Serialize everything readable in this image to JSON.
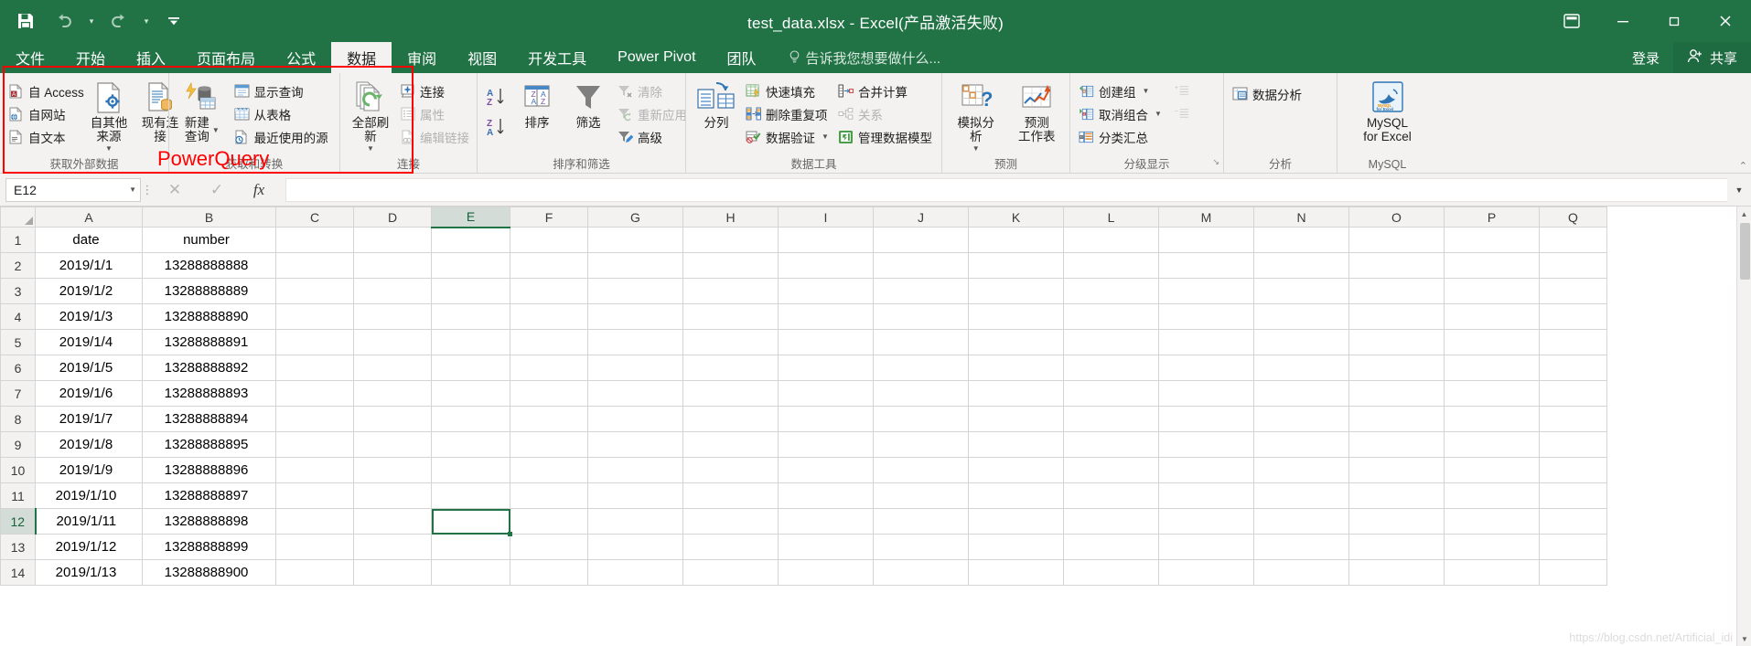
{
  "window": {
    "title": "test_data.xlsx - Excel(产品激活失败)",
    "quick_access": {
      "save": "save-icon",
      "undo": "undo-icon",
      "redo": "redo-icon",
      "customize": "customize-qat-icon"
    },
    "controls": {
      "ribbon_display": "ribbon-display-options",
      "minimize": "—",
      "restore": "restore",
      "close": "✕"
    }
  },
  "tabs": [
    {
      "label": "文件",
      "active": false
    },
    {
      "label": "开始",
      "active": false
    },
    {
      "label": "插入",
      "active": false
    },
    {
      "label": "页面布局",
      "active": false
    },
    {
      "label": "公式",
      "active": false
    },
    {
      "label": "数据",
      "active": true
    },
    {
      "label": "审阅",
      "active": false
    },
    {
      "label": "视图",
      "active": false
    },
    {
      "label": "开发工具",
      "active": false
    },
    {
      "label": "Power Pivot",
      "active": false
    },
    {
      "label": "团队",
      "active": false
    }
  ],
  "tellme": {
    "label": "告诉我您想要做什么...",
    "icon": "lightbulb-icon"
  },
  "account": {
    "signin": "登录",
    "share": "共享",
    "share_icon": "share-person-icon"
  },
  "ribbon": {
    "groups": [
      {
        "label": "获取外部数据",
        "small": [
          {
            "label": "自 Access",
            "icon": "access-file-icon",
            "disabled": false
          },
          {
            "label": "自网站",
            "icon": "web-globe-icon",
            "disabled": false
          },
          {
            "label": "自文本",
            "icon": "text-file-icon",
            "disabled": false
          }
        ],
        "big": [
          {
            "label": "自其他来源",
            "icon": "other-sources-icon",
            "dropdown": true
          },
          {
            "label": "现有连接",
            "icon": "existing-connection-icon",
            "dropdown": false
          }
        ]
      },
      {
        "label": "获取和转换",
        "big": [
          {
            "label": "新建\n查询",
            "icon": "new-query-icon",
            "dropdown": true,
            "inline_caret": true
          }
        ],
        "small": [
          {
            "label": "显示查询",
            "icon": "show-queries-icon",
            "disabled": false
          },
          {
            "label": "从表格",
            "icon": "from-table-icon",
            "disabled": false
          },
          {
            "label": "最近使用的源",
            "icon": "recent-sources-icon",
            "disabled": false
          }
        ]
      },
      {
        "label": "连接",
        "big": [
          {
            "label": "全部刷新",
            "icon": "refresh-all-icon",
            "dropdown": true
          }
        ],
        "small": [
          {
            "label": "连接",
            "icon": "connections-icon",
            "disabled": false
          },
          {
            "label": "属性",
            "icon": "properties-icon",
            "disabled": true
          },
          {
            "label": "编辑链接",
            "icon": "edit-links-icon",
            "disabled": true
          }
        ]
      },
      {
        "label": "排序和筛选",
        "sortbtns": [
          {
            "label": "升序排序",
            "icon": "sort-az-icon"
          },
          {
            "label": "降序排序",
            "icon": "sort-za-icon"
          }
        ],
        "big": [
          {
            "label": "排序",
            "icon": "sort-dialog-icon",
            "dropdown": false
          },
          {
            "label": "筛选",
            "icon": "filter-icon",
            "dropdown": false
          }
        ],
        "small": [
          {
            "label": "清除",
            "icon": "clear-filter-icon",
            "disabled": true
          },
          {
            "label": "重新应用",
            "icon": "reapply-icon",
            "disabled": true
          },
          {
            "label": "高级",
            "icon": "advanced-filter-icon",
            "disabled": false
          }
        ]
      },
      {
        "label": "数据工具",
        "big": [
          {
            "label": "分列",
            "icon": "text-to-columns-icon",
            "dropdown": false
          }
        ],
        "small": [
          {
            "label": "快速填充",
            "icon": "flash-fill-icon",
            "disabled": false
          },
          {
            "label": "删除重复项",
            "icon": "remove-duplicates-icon",
            "disabled": false
          },
          {
            "label": "数据验证",
            "icon": "data-validation-icon",
            "disabled": false,
            "caret": true
          }
        ],
        "small2": [
          {
            "label": "合并计算",
            "icon": "consolidate-icon",
            "disabled": false
          },
          {
            "label": "关系",
            "icon": "relationships-icon",
            "disabled": true
          },
          {
            "label": "管理数据模型",
            "icon": "manage-data-model-icon",
            "disabled": false
          }
        ]
      },
      {
        "label": "预测",
        "big": [
          {
            "label": "模拟分析",
            "icon": "what-if-analysis-icon",
            "dropdown": true
          },
          {
            "label": "预测\n工作表",
            "icon": "forecast-sheet-icon",
            "dropdown": false
          }
        ]
      },
      {
        "label": "分级显示",
        "small": [
          {
            "label": "创建组",
            "icon": "group-icon",
            "disabled": false,
            "caret": true
          },
          {
            "label": "取消组合",
            "icon": "ungroup-icon",
            "disabled": false,
            "caret": true
          },
          {
            "label": "分类汇总",
            "icon": "subtotal-icon",
            "disabled": false
          }
        ],
        "small2": [
          {
            "label": "",
            "icon": "show-detail-icon",
            "disabled": true
          },
          {
            "label": "",
            "icon": "hide-detail-icon",
            "disabled": true
          }
        ],
        "dialog_launcher": "↘"
      },
      {
        "label": "分析",
        "small": [
          {
            "label": "数据分析",
            "icon": "data-analysis-icon",
            "disabled": false
          }
        ]
      },
      {
        "label": "MySQL",
        "big": [
          {
            "label": "MySQL\nfor Excel",
            "icon": "mysql-dolphin-icon",
            "dropdown": false
          }
        ]
      }
    ],
    "collapse": "collapse-ribbon-icon"
  },
  "annotation": {
    "text": "PowerQuery",
    "color": "#ff0000"
  },
  "formula_bar": {
    "name_box": "E12",
    "cancel_icon": "cancel-icon",
    "enter_icon": "confirm-icon",
    "function_icon": "fx",
    "value": "",
    "expand_icon": "expand-formula-bar-icon"
  },
  "sheet": {
    "columns": [
      "A",
      "B",
      "C",
      "D",
      "E",
      "F",
      "G",
      "H",
      "I",
      "J",
      "K",
      "L",
      "M",
      "N",
      "O",
      "P",
      "Q"
    ],
    "selected_column": "E",
    "selected_row": 12,
    "active_cell": "E12",
    "rows": [
      {
        "n": 1,
        "A": "date",
        "B": "number"
      },
      {
        "n": 2,
        "A": "2019/1/1",
        "B": "13288888888"
      },
      {
        "n": 3,
        "A": "2019/1/2",
        "B": "13288888889"
      },
      {
        "n": 4,
        "A": "2019/1/3",
        "B": "13288888890"
      },
      {
        "n": 5,
        "A": "2019/1/4",
        "B": "13288888891"
      },
      {
        "n": 6,
        "A": "2019/1/5",
        "B": "13288888892"
      },
      {
        "n": 7,
        "A": "2019/1/6",
        "B": "13288888893"
      },
      {
        "n": 8,
        "A": "2019/1/7",
        "B": "13288888894"
      },
      {
        "n": 9,
        "A": "2019/1/8",
        "B": "13288888895"
      },
      {
        "n": 10,
        "A": "2019/1/9",
        "B": "13288888896"
      },
      {
        "n": 11,
        "A": "2019/1/10",
        "B": "13288888897"
      },
      {
        "n": 12,
        "A": "2019/1/11",
        "B": "13288888898"
      },
      {
        "n": 13,
        "A": "2019/1/12",
        "B": "13288888899"
      },
      {
        "n": 14,
        "A": "2019/1/13",
        "B": "13288888900"
      }
    ]
  },
  "watermark": "https://blog.csdn.net/Artificial_idi",
  "colors": {
    "excel_green": "#217346",
    "ribbon_bg": "#f3f2f1",
    "annotation_red": "#ff0000"
  }
}
